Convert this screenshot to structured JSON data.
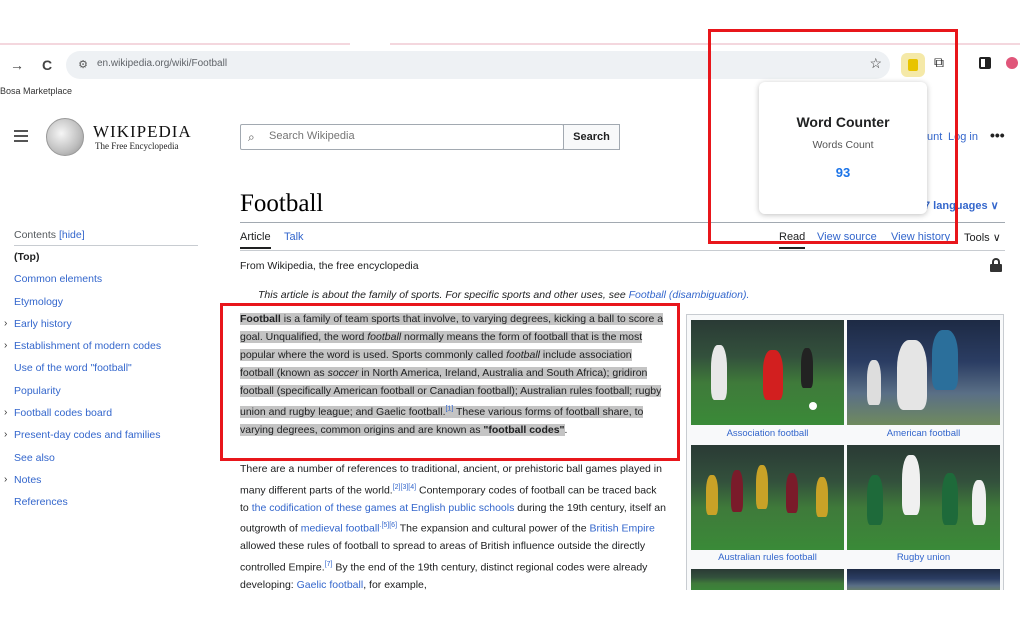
{
  "browser": {
    "back_glyph": "→",
    "reload_glyph": "C",
    "url": "en.wikipedia.org/wiki/Football",
    "bookmark": "Bosa Marketplace"
  },
  "wiki": {
    "wordmark": "WIKIPEDIA",
    "tagline": "The Free Encyclopedia",
    "search_placeholder": "Search Wikipedia",
    "search_button": "Search",
    "account_link": "unt",
    "login_link": "Log in",
    "more_glyph": "•••",
    "title": "Football",
    "languages": "7 languages ∨",
    "tabs": {
      "article": "Article",
      "talk": "Talk",
      "read": "Read",
      "view_source": "View source",
      "view_history": "View history",
      "tools": "Tools ∨"
    },
    "from_wiki": "From Wikipedia, the free encyclopedia",
    "hatnote": {
      "text": "This article is about the family of sports. For specific sports and other uses, see",
      "link": "Football (disambiguation).",
      "end": ""
    }
  },
  "toc": {
    "heading": "Contents",
    "hide": "[hide]",
    "items": [
      {
        "label": "(Top)",
        "chevron": ""
      },
      {
        "label": "Common elements",
        "chevron": ""
      },
      {
        "label": "Etymology",
        "chevron": ""
      },
      {
        "label": "Early history",
        "chevron": "›"
      },
      {
        "label": "Establishment of modern codes",
        "chevron": "›"
      },
      {
        "label": "Use of the word \"football\"",
        "chevron": ""
      },
      {
        "label": "Popularity",
        "chevron": ""
      },
      {
        "label": "Football codes board",
        "chevron": "›"
      },
      {
        "label": "Present-day codes and families",
        "chevron": "›"
      },
      {
        "label": "See also",
        "chevron": ""
      },
      {
        "label": "Notes",
        "chevron": "›"
      },
      {
        "label": "References",
        "chevron": ""
      }
    ]
  },
  "lead": {
    "bold_start": "Football",
    "text1": " is a family of team sports that involve, to varying degrees, kicking a ball to score a goal. Unqualified, the word ",
    "italic1": "football",
    "text2": " normally means the form of football that is the most popular where the word is used. Sports commonly called ",
    "italic2": "football",
    "text3": " include association football (known as ",
    "italic3": "soccer",
    "text4": " in North America, Ireland, Australia and South Africa); gridiron football (specifically American football or Canadian football); Australian rules football; rugby union and rugby league; and Gaelic football.",
    "ref1": "[1]",
    "text5": " These various forms of football share, to varying degrees, common origins and are known as ",
    "bold_end": "\"football codes\"",
    "text6": "."
  },
  "para2": {
    "t1": "There are a number of references to traditional, ancient, or prehistoric ball games played in many different parts of the world.",
    "ref1": "[2][3][4]",
    "t2": " Contemporary codes of football can be traced back to ",
    "link1": "the codification of these games at English public schools",
    "t3": " during the 19th century, itself an outgrowth of ",
    "link2": "medieval football",
    "ref2": ".[5][6]",
    "t4": " The expansion and cultural power of the ",
    "link3": "British Empire",
    "t5": " allowed these rules of football to spread to areas of British influence outside the directly controlled Empire.",
    "ref3": "[7]",
    "t6": " By the end of the 19th century, distinct regional codes were already developing: ",
    "link4": "Gaelic football",
    "t7": ", for example,"
  },
  "gallery": {
    "captions": [
      "Association football",
      "American football",
      "Australian rules football",
      "Rugby union"
    ]
  },
  "popup": {
    "title": "Word Counter",
    "subtitle": "Words Count",
    "count": "93"
  },
  "colors": {
    "highlight_box": "#e8161b",
    "link": "#3366cc",
    "count": "#1a73e8"
  }
}
